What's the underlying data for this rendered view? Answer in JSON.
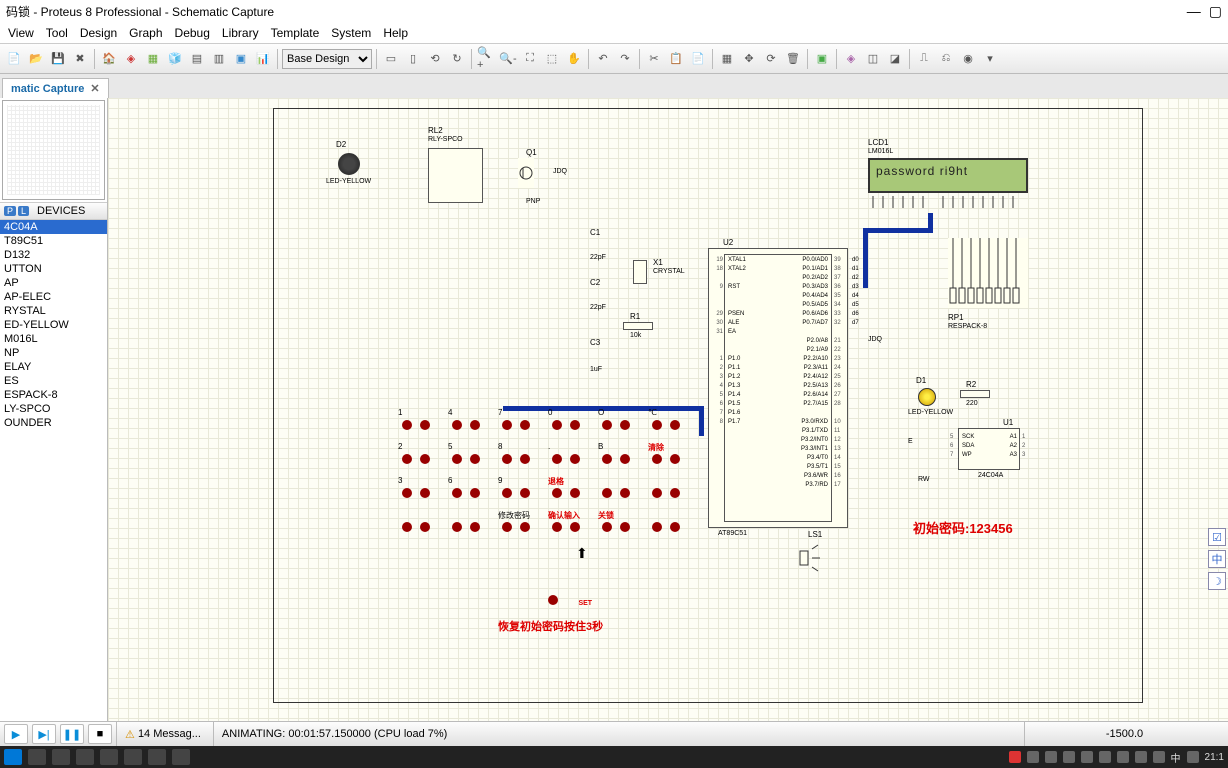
{
  "title": "码锁 - Proteus 8 Professional - Schematic Capture",
  "menu": [
    "View",
    "Tool",
    "Design",
    "Graph",
    "Debug",
    "Library",
    "Template",
    "System",
    "Help"
  ],
  "design_selector": "Base Design",
  "tab": {
    "label": "matic Capture"
  },
  "devices_header": "DEVICES",
  "devices": [
    "4C04A",
    "T89C51",
    "D132",
    "UTTON",
    "AP",
    "AP-ELEC",
    "RYSTAL",
    "ED-YELLOW",
    "M016L",
    "NP",
    "ELAY",
    "ES",
    "ESPACK-8",
    "LY-SPCO",
    "OUNDER"
  ],
  "lcd": {
    "ref": "LCD1",
    "part": "LM016L",
    "text": "password ri9ht"
  },
  "mcu": {
    "ref": "U2",
    "part": "AT89C51"
  },
  "relay": {
    "ref": "RL2",
    "part": "RLY-SPCO"
  },
  "d2": {
    "ref": "D2",
    "part": "LED-YELLOW"
  },
  "q1": {
    "ref": "Q1",
    "part": "PNP",
    "net": "JDQ"
  },
  "d1": {
    "ref": "D1",
    "part": "LED-YELLOW"
  },
  "r1": {
    "ref": "R1",
    "val": "10k"
  },
  "r2": {
    "ref": "R2",
    "val": "220"
  },
  "c1": {
    "ref": "C1",
    "val": "22pF"
  },
  "c2": {
    "ref": "C2",
    "val": "22pF"
  },
  "c3": {
    "ref": "C3",
    "val": "1uF"
  },
  "x1": {
    "ref": "X1",
    "part": "CRYSTAL"
  },
  "u1": {
    "ref": "U1",
    "part": "24C04A"
  },
  "rp1": {
    "ref": "RP1",
    "part": "RESPACK-8"
  },
  "ls1": {
    "ref": "LS1"
  },
  "keypad": {
    "rows": [
      [
        "1",
        "4",
        "7",
        "0",
        "O",
        "℃"
      ],
      [
        "2",
        "5",
        "8",
        ".",
        "B",
        "清除"
      ],
      [
        "3",
        "6",
        "9",
        "退格",
        "",
        ""
      ],
      [
        "",
        "",
        "修改密码",
        "确认输入",
        "关锁",
        ""
      ]
    ]
  },
  "set_btn": "SET",
  "reset_text": "恢复初始密码按住3秒",
  "password_text": "初始密码:123456",
  "pins_left": [
    "XTAL1",
    "XTAL2",
    "",
    "RST",
    "",
    "",
    "PSEN",
    "ALE",
    "EA",
    "",
    "",
    "P1.0",
    "P1.1",
    "P1.2",
    "P1.3",
    "P1.4",
    "P1.5",
    "P1.6",
    "P1.7"
  ],
  "pins_right": [
    "P0.0/AD0",
    "P0.1/AD1",
    "P0.2/AD2",
    "P0.3/AD3",
    "P0.4/AD4",
    "P0.5/AD5",
    "P0.6/AD6",
    "P0.7/AD7",
    "",
    "P2.0/A8",
    "P2.1/A9",
    "P2.2/A10",
    "P2.3/A11",
    "P2.4/A12",
    "P2.5/A13",
    "P2.6/A14",
    "P2.7/A15",
    "",
    "P3.0/RXD",
    "P3.1/TXD",
    "P3.2/INT0",
    "P3.3/INT1",
    "P3.4/T0",
    "P3.5/T1",
    "P3.6/WR",
    "P3.7/RD"
  ],
  "pin_nums_l": [
    "19",
    "18",
    "",
    "9",
    "",
    "",
    "29",
    "30",
    "31",
    "",
    "",
    "1",
    "2",
    "3",
    "4",
    "5",
    "6",
    "7",
    "8"
  ],
  "pin_nums_r": [
    "39",
    "38",
    "37",
    "36",
    "35",
    "34",
    "33",
    "32",
    "",
    "21",
    "22",
    "23",
    "24",
    "25",
    "26",
    "27",
    "28",
    "",
    "10",
    "11",
    "12",
    "13",
    "14",
    "15",
    "16",
    "17"
  ],
  "pin_nets": [
    "d0",
    "d1",
    "d2",
    "d3",
    "d4",
    "d5",
    "d6",
    "d7"
  ],
  "u1_pins_l": [
    "SCK",
    "SDA",
    "WP"
  ],
  "u1_pins_r": [
    "A1",
    "A2",
    "A3"
  ],
  "u1_nums_l": [
    "5",
    "6",
    "7"
  ],
  "u1_nums_r": [
    "1",
    "2",
    "3"
  ],
  "jdq_label": "JDQ",
  "e_label": "E",
  "rw_label": "RW",
  "status": {
    "messages": "14 Messag...",
    "anim": "ANIMATING: 00:01:57.150000 (CPU load 7%)",
    "coord": "-1500.0"
  },
  "taskbar_time": "21:1",
  "taskbar_lang": "中",
  "float": [
    "☑",
    "中",
    "☽"
  ]
}
